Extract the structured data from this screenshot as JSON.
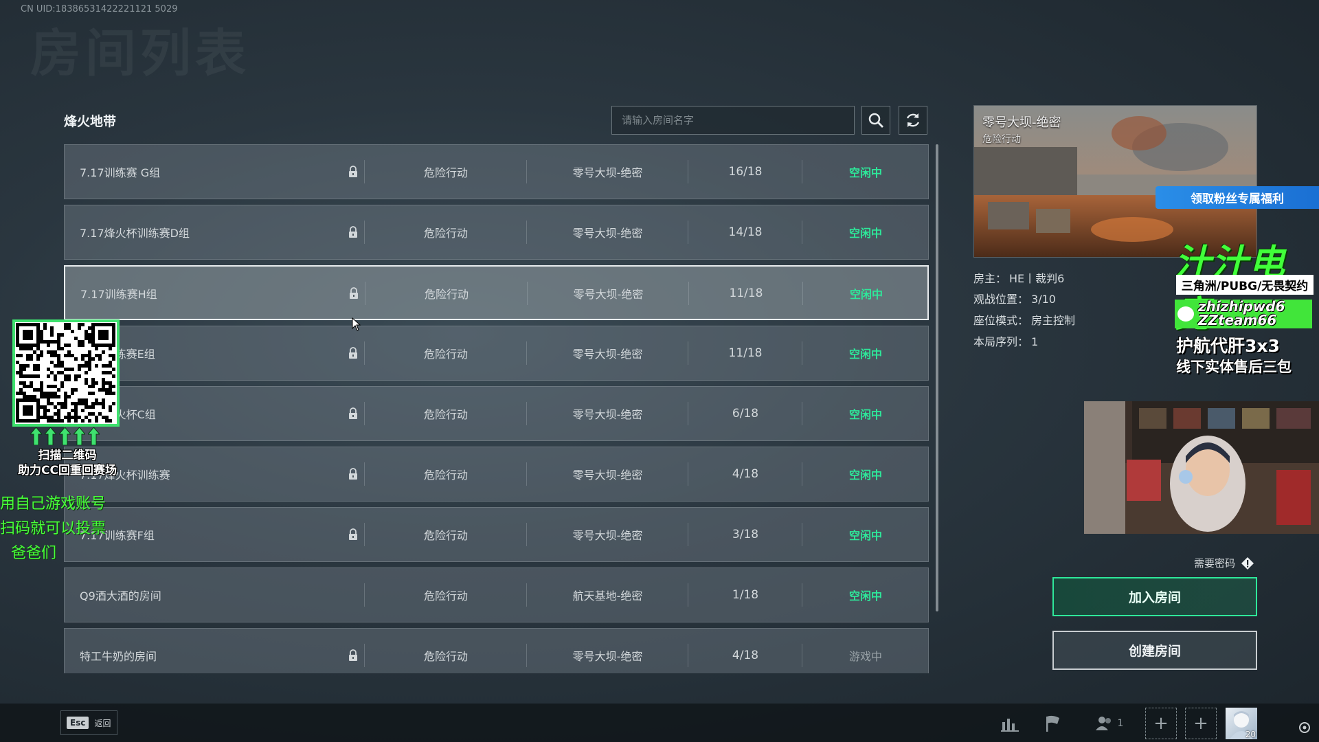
{
  "uid": "CN UID:18386531422221121 5029",
  "page_title": "房间列表",
  "section_title": "烽火地带",
  "search": {
    "placeholder": "请输入房间名字"
  },
  "rooms": [
    {
      "name": "7.17训练赛 G组",
      "locked": true,
      "mode": "危险行动",
      "map": "零号大坝-绝密",
      "players": "16/18",
      "status": "空闲中"
    },
    {
      "name": "7.17烽火杯训练赛D组",
      "locked": true,
      "mode": "危险行动",
      "map": "零号大坝-绝密",
      "players": "14/18",
      "status": "空闲中"
    },
    {
      "name": "7.17训练赛H组",
      "locked": true,
      "mode": "危险行动",
      "map": "零号大坝-绝密",
      "players": "11/18",
      "status": "空闲中"
    },
    {
      "name": "7.17训练赛E组",
      "locked": true,
      "mode": "危险行动",
      "map": "零号大坝-绝密",
      "players": "11/18",
      "status": "空闲中"
    },
    {
      "name": "7.17烽火杯C组",
      "locked": true,
      "mode": "危险行动",
      "map": "零号大坝-绝密",
      "players": "6/18",
      "status": "空闲中"
    },
    {
      "name": "7.17烽火杯训练赛",
      "locked": true,
      "mode": "危险行动",
      "map": "零号大坝-绝密",
      "players": "4/18",
      "status": "空闲中"
    },
    {
      "name": "7.17训练赛F组",
      "locked": true,
      "mode": "危险行动",
      "map": "零号大坝-绝密",
      "players": "3/18",
      "status": "空闲中"
    },
    {
      "name": "Q9酒大酒的房间",
      "locked": false,
      "mode": "危险行动",
      "map": "航天基地-绝密",
      "players": "1/18",
      "status": "空闲中"
    },
    {
      "name": "特工牛奶的房间",
      "locked": true,
      "mode": "危险行动",
      "map": "零号大坝-绝密",
      "players": "4/18",
      "status": "游戏中"
    }
  ],
  "selected_room_index": 2,
  "preview": {
    "map": "零号大坝-绝密",
    "mode": "危险行动"
  },
  "info": [
    {
      "label": "房主：",
      "value": "HE丨裁判6"
    },
    {
      "label": "观战位置：",
      "value": "3/10"
    },
    {
      "label": "座位模式：",
      "value": "房主控制"
    },
    {
      "label": "本局序列：",
      "value": "1"
    }
  ],
  "need_password": "需要密码",
  "join_button": "加入房间",
  "create_button": "创建房间",
  "esc": {
    "key": "Esc",
    "label": "返回"
  },
  "bottom": {
    "friends_count": "1",
    "avatar_level": "20"
  },
  "overlay": {
    "banner": "领取粉丝专属福利",
    "brand": "汁汁电竞",
    "games": "三角洲/PUBG/无畏契约",
    "wechat_1": "zhizhipwd6",
    "wechat_2": "ZZteam66",
    "line1": "护航代肝3x3",
    "line2": "线下实体售后三包",
    "scan_1": "扫描二维码",
    "scan_2": "助力CC回重回赛场",
    "green_1": "用自己游戏账号",
    "green_2": "扫码就可以投票",
    "green_3": "爸爸们"
  },
  "colors": {
    "accent_green": "#2ee89a",
    "status_idle": "#2ee89a",
    "status_playing": "#9aa3a8",
    "promo_green": "#41ff3a",
    "banner_blue": "#2a8ee8"
  }
}
